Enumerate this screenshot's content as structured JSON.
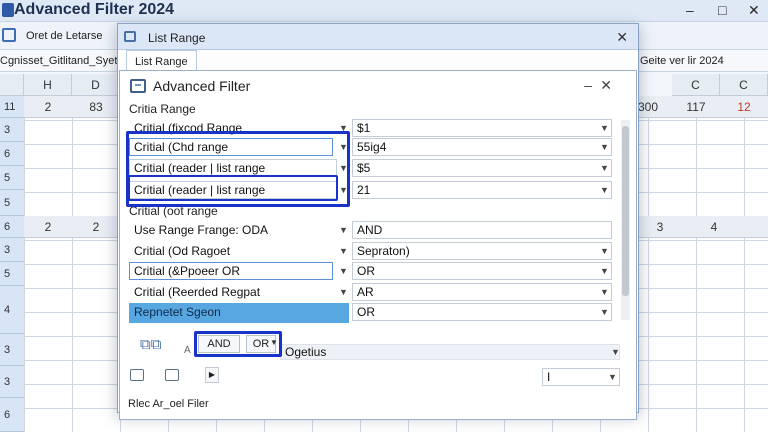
{
  "app": {
    "title": "Advanced Filter 2024",
    "controls": [
      "–",
      "□",
      "✕"
    ]
  },
  "ribbon": {
    "label": "Oret de Letarse"
  },
  "formula_bar": {
    "name_box": "Cgnisset_Gitlitand_Syetidc",
    "right_text": "Geite ver lir 2024"
  },
  "sheet": {
    "columns_left": [
      "",
      "H",
      "D"
    ],
    "columns_right": [
      "C",
      "C"
    ],
    "rows": [
      "11",
      "3",
      "6",
      "5",
      "5",
      "6",
      "3",
      "5",
      "4",
      "3",
      "3",
      "6"
    ],
    "row1_left_values": [
      "2",
      "83"
    ],
    "row1_right_values": [
      "300",
      "117",
      "12"
    ],
    "band_row_left_values": [
      "2",
      "2"
    ],
    "band_row_right_values": [
      "3",
      "4"
    ]
  },
  "outer_dialog": {
    "title": "List Range",
    "tab": "List Range"
  },
  "dialog": {
    "title": "Advanced Filter",
    "section_label": "Critia Range",
    "section2_label": "Critial (oot range",
    "rows": [
      {
        "label": "Critial (fixcod Range",
        "value": "$1"
      },
      {
        "label": "Critial (Chd range",
        "value": "55ig4"
      },
      {
        "label": "Critial (reader | list range",
        "value": "$5"
      },
      {
        "label": "Critial (reader | list range",
        "value": "21"
      },
      {
        "label": "Use Range Frange: ODA",
        "value": "AND"
      },
      {
        "label": "Critial (Od Ragoet",
        "value": "Sepraton)"
      },
      {
        "label": "Critial (&Ppoeer OR",
        "value": "OR"
      },
      {
        "label": "Critial (Reerded Regpat",
        "value": "AR"
      },
      {
        "label": "Repnetet Sgeon",
        "value": "OR"
      }
    ],
    "logic_and": "AND",
    "logic_or": "OR",
    "logic_hint": "Ogetius",
    "output_value": "I",
    "footer": "Rlec Ar_oel Filer"
  }
}
